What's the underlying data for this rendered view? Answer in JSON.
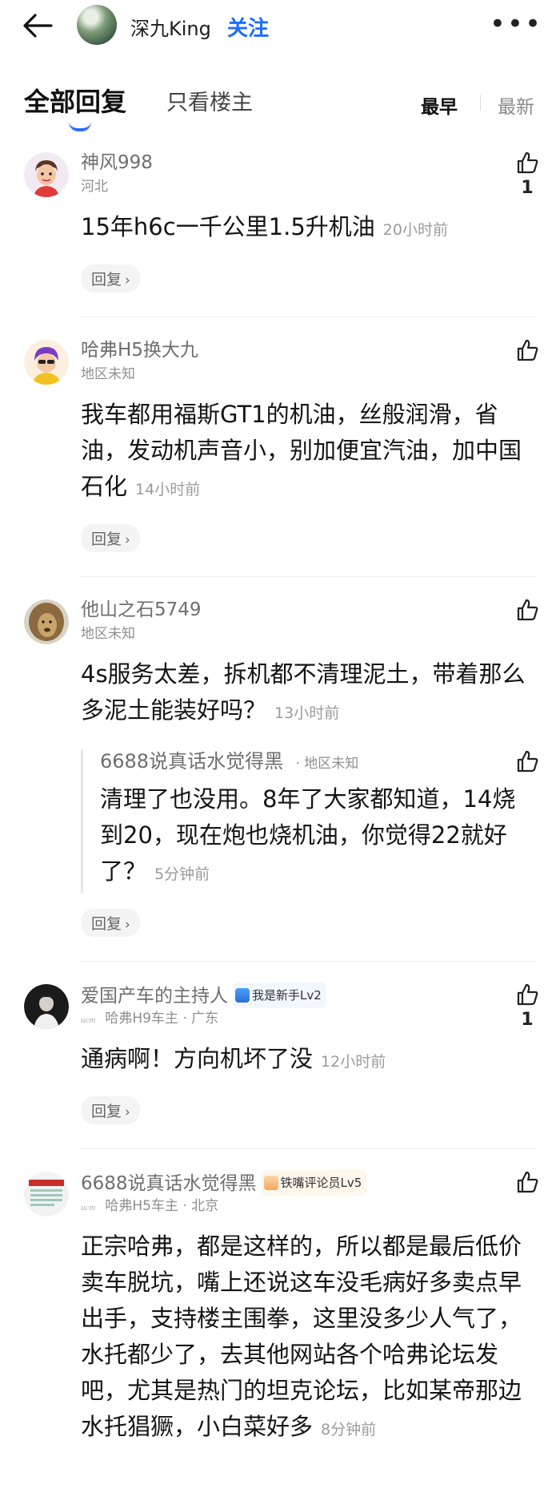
{
  "header": {
    "owner_name": "深九King",
    "follow_label": "关注"
  },
  "tabs": {
    "all": "全部回复",
    "owner_only": "只看楼主",
    "sort_earliest": "最早",
    "sort_newest": "最新"
  },
  "reply_label": "回复",
  "comments": [
    {
      "user": "神风998",
      "region": "河北",
      "text": "15年h6c一千公里1.5升机油",
      "time": "20小时前",
      "likes": "1"
    },
    {
      "user": "哈弗H5换大九",
      "region": "地区未知",
      "text": "我车都用福斯GT1的机油，丝般润滑，省油，发动机声音小，别加便宜汽油，加中国石化",
      "time": "14小时前"
    },
    {
      "user": "他山之石5749",
      "region": "地区未知",
      "text": "4s服务太差，拆机都不清理泥土，带着那么多泥土能装好吗？",
      "time": "13小时前",
      "sub_reply": {
        "user": "6688说真话水觉得黑",
        "region": "地区未知",
        "text": "清理了也没用。8年了大家都知道，14烧到20，现在炮也烧机油，你觉得22就好了？",
        "time": "5分钟前"
      }
    },
    {
      "user": "爱国产车的主持人",
      "badge": "我是新手Lv2",
      "car_tag": "ucm",
      "car": "哈弗H9车主",
      "region": "广东",
      "text": "通病啊！方向机坏了没",
      "time": "12小时前",
      "likes": "1"
    },
    {
      "user": "6688说真话水觉得黑",
      "badge": "铁嘴评论员Lv5",
      "car_tag": "ucm",
      "car": "哈弗H5车主",
      "region": "北京",
      "text": "正宗哈弗，都是这样的，所以都是最后低价卖车脱坑，嘴上还说这车没毛病好多卖点早出手，支持楼主围拳，这里没多少人气了，水托都少了，去其他网站各个哈弗论坛发吧，尤其是热门的坦克论坛，比如某帝那边水托猖獗，小白菜好多",
      "time": "8分钟前"
    }
  ],
  "colors": {
    "accent": "#1a6dff",
    "tab_underline": "#2b6cff"
  }
}
